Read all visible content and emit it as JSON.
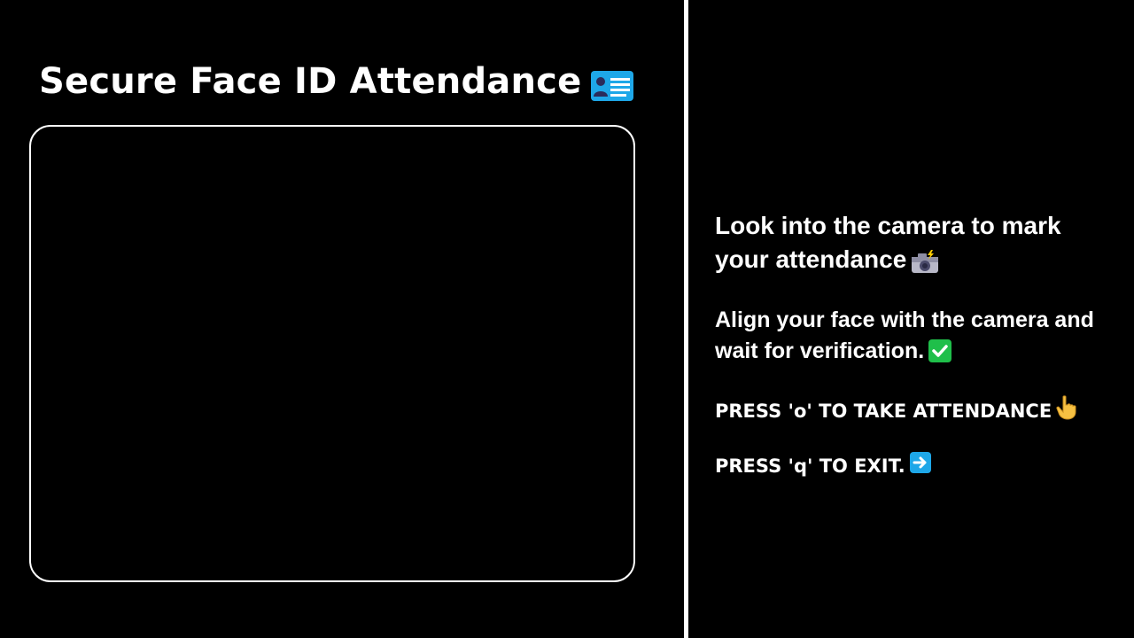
{
  "app": {
    "title": "Secure Face ID Attendance",
    "title_icon": "id-card-icon"
  },
  "camera": {
    "state": "empty"
  },
  "instructions": {
    "heading": "Look into the camera to mark your attendance",
    "heading_icon": "camera-with-flash-icon",
    "body": "Align your face with the camera and wait for verification.",
    "body_icon": "check-mark-icon",
    "press_attendance": "PRESS 'o' TO TAKE ATTENDANCE",
    "press_attendance_icon": "pointing-hand-icon",
    "press_exit": "PRESS 'q' TO EXIT.",
    "press_exit_icon": "right-arrow-icon"
  },
  "colors": {
    "background": "#000000",
    "text": "#ffffff",
    "divider": "#ffffff",
    "frame_border": "#ffffff",
    "icon_blue": "#1ea7e8",
    "check_green": "#1fbf4a"
  }
}
